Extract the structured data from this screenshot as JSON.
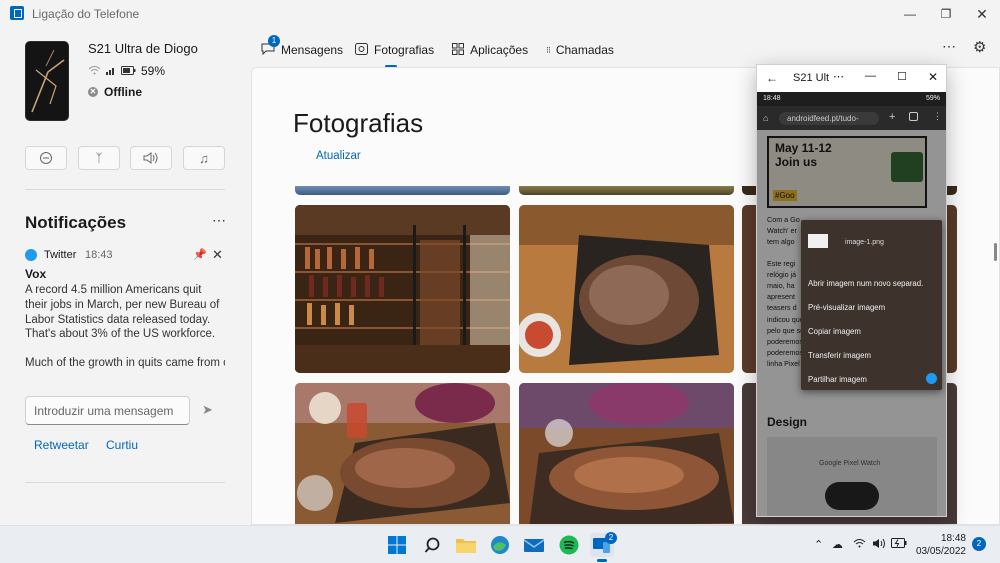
{
  "window": {
    "title": "Ligação do Telefone"
  },
  "device": {
    "name": "S21 Ultra de Diogo",
    "battery": "59%",
    "status": "Offline"
  },
  "notifications": {
    "title": "Notificações",
    "item": {
      "app": "Twitter",
      "time": "18:43",
      "title": "Vox",
      "body": "A record 4.5 million Americans quit their jobs in March, per new Bureau of Labor Statistics data released today. That's about 3% of the US workforce.",
      "body2": "Much of the growth in quits came from older, more tenured workers, @ranimol..."
    },
    "reply_placeholder": "Introduzir uma mensagem",
    "actions": {
      "retweet": "Retweetar",
      "like": "Curtiu"
    }
  },
  "nav": {
    "messages": "Mensagens",
    "messages_badge": "1",
    "photos": "Fotografias",
    "apps": "Aplicações",
    "calls": "Chamadas"
  },
  "photos_page": {
    "title": "Fotografias",
    "refresh": "Atualizar"
  },
  "mirror": {
    "title": "S21 Ult",
    "phone_time": "18:48",
    "phone_battery": "59%",
    "url": "androidfeed.pt/tudo-",
    "banner_line1": "May 11-12",
    "banner_line2": "Join us",
    "banner_tag": "#Goo",
    "article_lines": [
      "Com a Go",
      "Watch' er",
      "tem algo",
      "Este regi",
      "relógio já",
      "maio, ha",
      "apresent",
      "teasers d",
      "indicou que não faltava muito para o vermos,",
      "pelo que só nos dias 11 e 12 de maio",
      "poderemos saber alguma coisa. Contudo,",
      "poderemos ver este relógio somente com a",
      "linha Pixel 7, no outono."
    ],
    "section_heading": "Design",
    "card_label": "Google Pixel Watch",
    "context_menu": {
      "filename": "image-1.png",
      "items": [
        "Abrir imagem num novo separad.",
        "Pré-visualizar imagem",
        "Copiar imagem",
        "Transferir imagem",
        "Partilhar imagem"
      ]
    }
  },
  "taskbar": {
    "time": "18:48",
    "date": "03/05/2022",
    "notif_count": "2",
    "phone_badge": "2"
  },
  "colors": {
    "accent": "#0067c0",
    "twitter": "#1d9bf0"
  }
}
